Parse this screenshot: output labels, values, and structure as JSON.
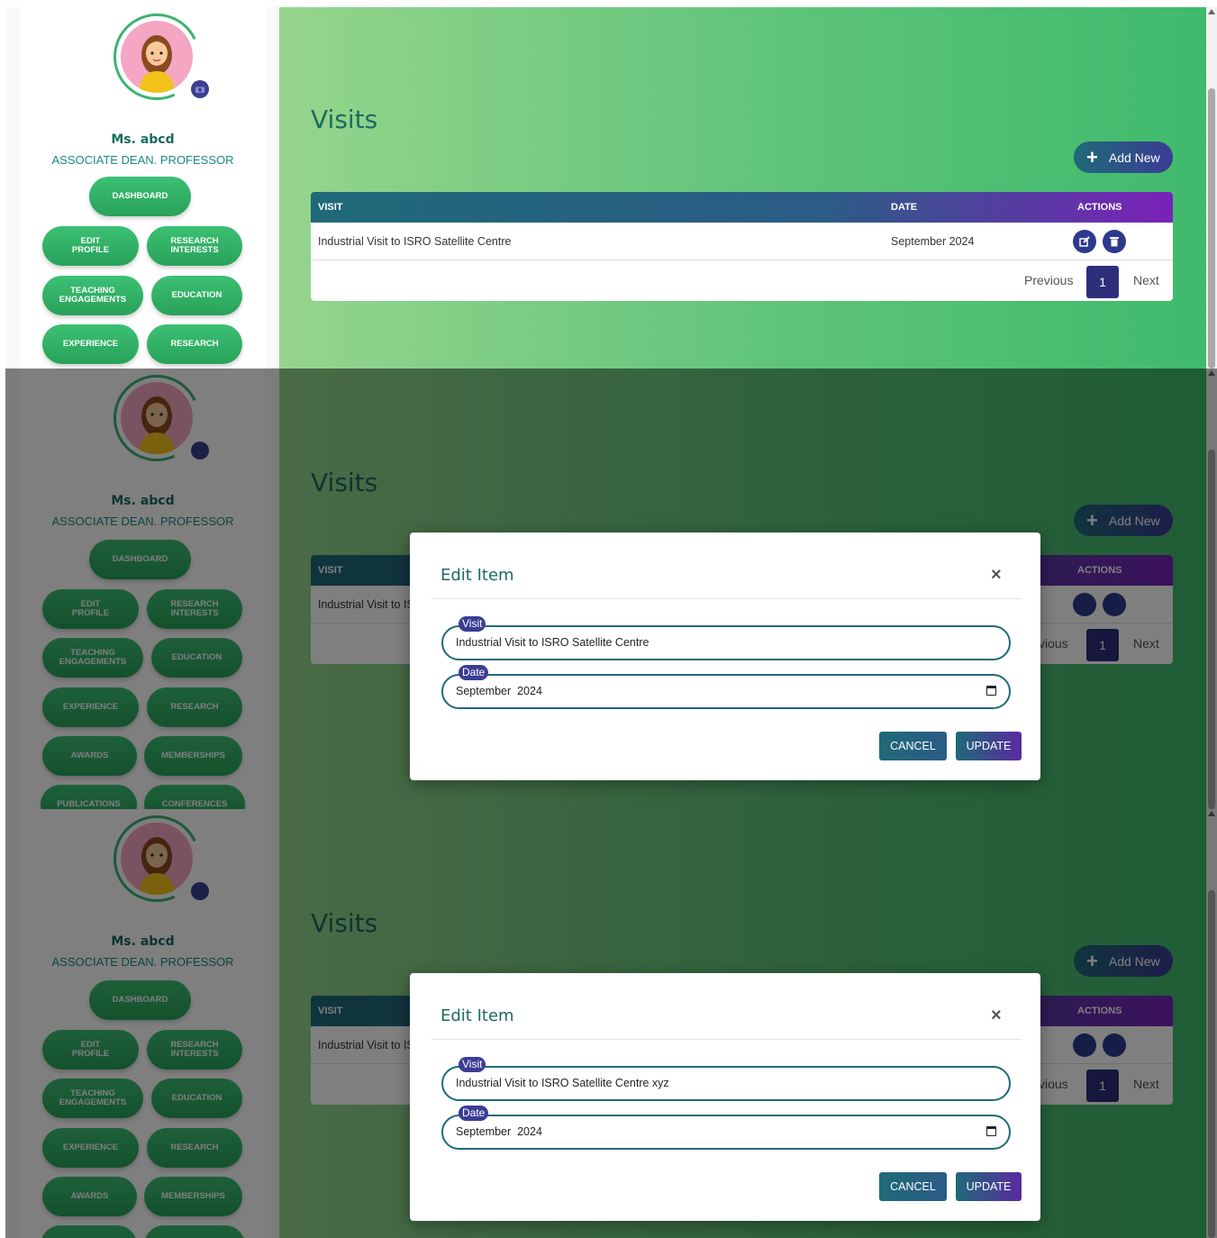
{
  "sidebar": {
    "name": "Ms. abcd",
    "role": "ASSOCIATE DEAN. PROFESSOR",
    "buttons": {
      "dashboard": "DASHBOARD",
      "edit_profile_1": "EDIT",
      "edit_profile_2": "PROFILE",
      "research_interests_1": "RESEARCH",
      "research_interests_2": "INTERESTS",
      "teaching_1": "TEACHING",
      "teaching_2": "ENGAGEMENTS",
      "education": "EDUCATION",
      "experience": "EXPERIENCE",
      "research": "RESEARCH",
      "awards": "AWARDS",
      "memberships": "MEMBERSHIPS",
      "publications": "PUBLICATIONS",
      "conferences": "CONFERENCES"
    }
  },
  "main": {
    "title": "Visits",
    "add_button": "Add New",
    "table": {
      "headers": [
        "VISIT",
        "DATE",
        "ACTIONS"
      ],
      "rows": [
        {
          "visit": "Industrial Visit to ISRO Satellite Centre",
          "visit_partial": "Industrial Visit to IS",
          "date": "September 2024"
        }
      ]
    },
    "pager": {
      "previous": "Previous",
      "previous_partial": "vious",
      "page": "1",
      "next": "Next"
    }
  },
  "modal_1": {
    "title": "Edit Item",
    "close": "×",
    "visit_label": "Visit",
    "visit_value": "Industrial Visit to ISRO Satellite Centre",
    "date_label": "Date",
    "date_value": "September  2024",
    "cancel": "CANCEL",
    "update": "UPDATE"
  },
  "modal_2": {
    "title": "Edit Item",
    "close": "×",
    "visit_label": "Visit",
    "visit_value": "Industrial Visit to ISRO Satellite Centre xyz",
    "date_label": "Date",
    "date_value": "September  2024",
    "cancel": "CANCEL",
    "update": "UPDATE"
  },
  "colors": {
    "accent": "#1a6b5f",
    "button_green": "#3cc074",
    "header_purple": "#7a22b8",
    "modal_label": "#3b3c94"
  }
}
